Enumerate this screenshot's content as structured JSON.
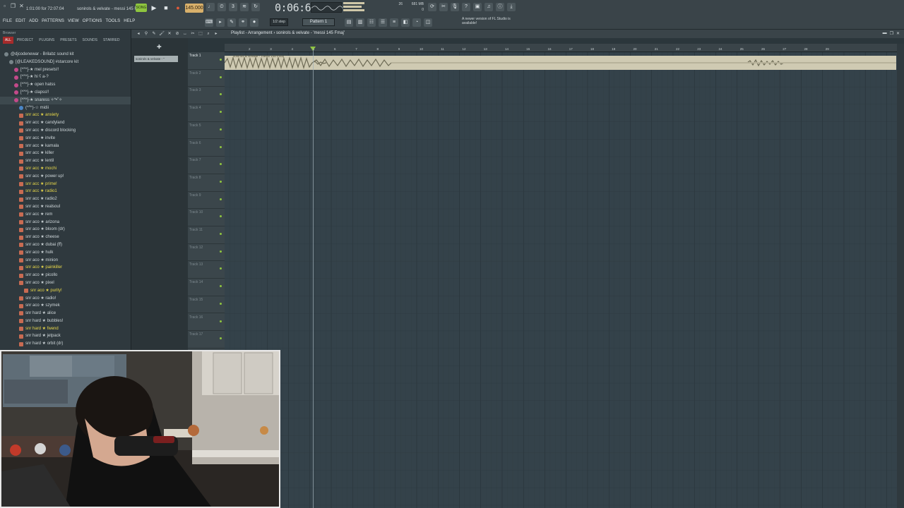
{
  "app": {
    "hint_text": "1:01:00 for 72:07:04",
    "project_name": "sonirols & velvate - messi 145 Fmaj",
    "tempo": "145.000",
    "time": "0:06:62",
    "mem": "681 MB",
    "cpu": "26",
    "cpu2": "0",
    "menu": [
      "FILE",
      "EDIT",
      "ADD",
      "PATTERNS",
      "VIEW",
      "OPTIONS",
      "TOOLS",
      "HELP"
    ],
    "snap": "1/2 step",
    "pattern": "Pattern 1",
    "news": "A newer version of FL Studio is available!"
  },
  "browser": {
    "head": "Browser",
    "tabs": [
      "ALL",
      "PROJECT",
      "PLUGINS",
      "PRESETS",
      "SOUNDS",
      "STARRED"
    ],
    "items": [
      {
        "label": "@djcodenewar - Brilabz sound kit",
        "icon": "grey",
        "indent": 0,
        "style": "normal"
      },
      {
        "label": "[@LEAKEDSOUND] #starcore kit",
        "icon": "grey",
        "indent": 1,
        "style": "normal"
      },
      {
        "label": "[^˟^]-★ mel presets!!",
        "icon": "pink",
        "indent": 2,
        "style": "normal"
      },
      {
        "label": "[^˟^]-★ hi ʕ a-?",
        "icon": "pink",
        "indent": 2,
        "style": "normal"
      },
      {
        "label": "[^˟^]-★ open hatss",
        "icon": "pink",
        "indent": 2,
        "style": "normal"
      },
      {
        "label": "[^˟^]-★ clapss!!",
        "icon": "pink",
        "indent": 2,
        "style": "normal"
      },
      {
        "label": "[^˟^]-★ snaress ✧*•˚✧",
        "icon": "pink",
        "indent": 2,
        "style": "selected"
      },
      {
        "label": "(^˟^)-☆ midii",
        "icon": "blue",
        "indent": 3,
        "style": "normal"
      },
      {
        "label": "snr acc ★ anxiety",
        "icon": "folder",
        "indent": 3,
        "style": "yellow"
      },
      {
        "label": "snr acc ★ candyland",
        "icon": "folder",
        "indent": 3,
        "style": "normal"
      },
      {
        "label": "snr acc ★ discord blocking",
        "icon": "folder",
        "indent": 3,
        "style": "normal"
      },
      {
        "label": "snr acc ★ invite",
        "icon": "folder",
        "indent": 3,
        "style": "normal"
      },
      {
        "label": "snr acc ★ kamala",
        "icon": "folder",
        "indent": 3,
        "style": "normal"
      },
      {
        "label": "snr acc ★ killer",
        "icon": "folder",
        "indent": 3,
        "style": "normal"
      },
      {
        "label": "snr acc ★ lentil",
        "icon": "folder",
        "indent": 3,
        "style": "normal"
      },
      {
        "label": "snr acc ★ mochi",
        "icon": "folder",
        "indent": 3,
        "style": "yellow"
      },
      {
        "label": "snr acc ★ power up!",
        "icon": "folder",
        "indent": 3,
        "style": "normal"
      },
      {
        "label": "snr acc ★ prime!",
        "icon": "folder",
        "indent": 3,
        "style": "yellow"
      },
      {
        "label": "snr acc ★ radio1",
        "icon": "folder",
        "indent": 3,
        "style": "yellow"
      },
      {
        "label": "snr acc ★ radio2",
        "icon": "folder",
        "indent": 3,
        "style": "normal"
      },
      {
        "label": "snr acc ★ realsoul",
        "icon": "folder",
        "indent": 3,
        "style": "normal"
      },
      {
        "label": "snr acc ★ rem",
        "icon": "folder",
        "indent": 3,
        "style": "normal"
      },
      {
        "label": "snr aco ★ arizona",
        "icon": "folder",
        "indent": 3,
        "style": "normal"
      },
      {
        "label": "snr aco ★ bloom (dr)",
        "icon": "folder",
        "indent": 3,
        "style": "normal"
      },
      {
        "label": "snr aco ★ cheese",
        "icon": "folder",
        "indent": 3,
        "style": "normal"
      },
      {
        "label": "snr aco ★ dubai (ff)",
        "icon": "folder",
        "indent": 3,
        "style": "normal"
      },
      {
        "label": "snr aco ★ hulk",
        "icon": "folder",
        "indent": 3,
        "style": "normal"
      },
      {
        "label": "snr aco ★ minion",
        "icon": "folder",
        "indent": 3,
        "style": "normal"
      },
      {
        "label": "snr aco ★ painkiller",
        "icon": "folder",
        "indent": 3,
        "style": "yellow"
      },
      {
        "label": "snr aco ★ picollo",
        "icon": "folder",
        "indent": 3,
        "style": "normal"
      },
      {
        "label": "snr aco ★ pixel",
        "icon": "folder",
        "indent": 3,
        "style": "normal"
      },
      {
        "label": "snr aco ★ purity!",
        "icon": "folder",
        "indent": 4,
        "style": "yellow"
      },
      {
        "label": "snr aco ★ radio!",
        "icon": "folder",
        "indent": 3,
        "style": "normal"
      },
      {
        "label": "snr aco ★ szymek",
        "icon": "folder",
        "indent": 3,
        "style": "normal"
      },
      {
        "label": "snr hard ★ alice",
        "icon": "folder",
        "indent": 3,
        "style": "normal"
      },
      {
        "label": "snr hard ★ bubbles!",
        "icon": "folder",
        "indent": 3,
        "style": "normal"
      },
      {
        "label": "snr hard ★ fwend",
        "icon": "folder",
        "indent": 3,
        "style": "yellow"
      },
      {
        "label": "snr hard ★ jetpack",
        "icon": "folder",
        "indent": 3,
        "style": "normal"
      },
      {
        "label": "snr hard ★ orbit (dr)",
        "icon": "folder",
        "indent": 3,
        "style": "normal"
      }
    ]
  },
  "picker": {
    "clip": "sonirols & velvate - \" "
  },
  "playlist": {
    "title": "Playlist - Arrangement › sonirols & velvate - 'messi 145 Fmaj'",
    "clip_label": "sonirols & velvate - 'messi 145 Fmaj'",
    "ruler_ticks": [
      "2",
      "3",
      "4",
      "5",
      "6",
      "7",
      "8",
      "9",
      "10",
      "11",
      "12",
      "13",
      "14",
      "15",
      "16",
      "17",
      "18",
      "19",
      "20",
      "21",
      "22",
      "23",
      "24",
      "25",
      "26",
      "27",
      "28",
      "29"
    ],
    "tracks": [
      "Track 1",
      "Track 2",
      "Track 3",
      "Track 4",
      "Track 5",
      "Track 6",
      "Track 7",
      "Track 8",
      "Track 9",
      "Track 10",
      "Track 11",
      "Track 12",
      "Track 13",
      "Track 14",
      "Track 15",
      "Track 16",
      "Track 17"
    ]
  },
  "colors": {
    "accent": "#8ec63f",
    "clip": "#cfcab2",
    "grid": "#34424a",
    "yellow_text": "#e8d84a"
  }
}
